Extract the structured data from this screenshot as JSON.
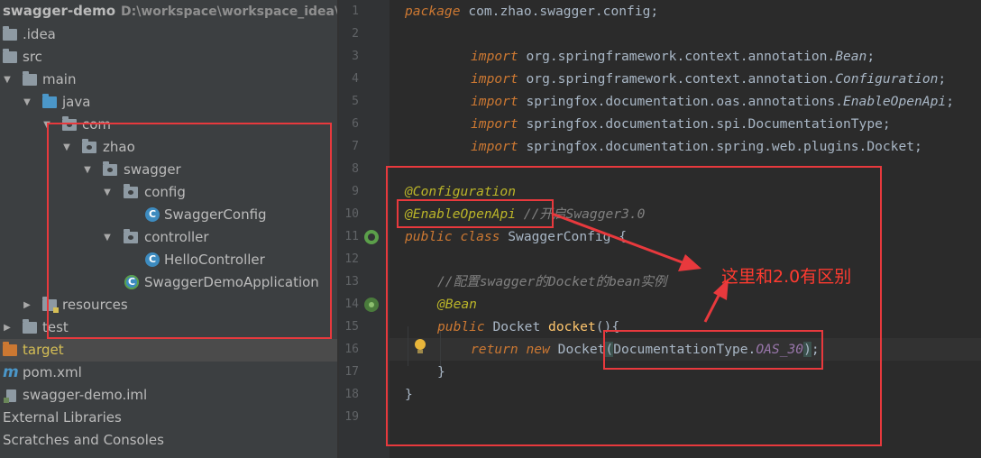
{
  "project": {
    "root_name": "swagger-demo",
    "root_path": "D:\\workspace\\workspace_idea\\java",
    "items": [
      {
        "label": ".idea"
      },
      {
        "label": "src"
      },
      {
        "label": "main"
      },
      {
        "label": "java"
      },
      {
        "label": "com"
      },
      {
        "label": "zhao"
      },
      {
        "label": "swagger"
      },
      {
        "label": "config"
      },
      {
        "label": "SwaggerConfig"
      },
      {
        "label": "controller"
      },
      {
        "label": "HelloController"
      },
      {
        "label": "SwaggerDemoApplication"
      },
      {
        "label": "resources"
      },
      {
        "label": "test"
      },
      {
        "label": "target"
      },
      {
        "label": "pom.xml"
      },
      {
        "label": "swagger-demo.iml"
      },
      {
        "label": "External Libraries"
      },
      {
        "label": "Scratches and Consoles"
      }
    ],
    "icons": {
      "class_letter": "C",
      "maven_letter": "m"
    }
  },
  "editor": {
    "line_numbers": [
      "1",
      "2",
      "3",
      "4",
      "5",
      "6",
      "7",
      "8",
      "9",
      "10",
      "11",
      "12",
      "13",
      "14",
      "15",
      "16",
      "17",
      "18",
      "19"
    ],
    "line1": {
      "kw": "package",
      "pkg": "com.zhao.swagger.config;"
    },
    "imports": [
      {
        "kw": "import",
        "pkg": "org.springframework.context.annotation.",
        "cls": "Bean",
        "end": ";"
      },
      {
        "kw": "import",
        "pkg": "org.springframework.context.annotation.",
        "cls": "Configuration",
        "end": ";"
      },
      {
        "kw": "import",
        "pkg": "springfox.documentation.oas.annotations.",
        "cls": "EnableOpenApi",
        "end": ";"
      },
      {
        "kw": "import",
        "pkg": "springfox.documentation.spi.DocumentationType;",
        "cls": "",
        "end": ""
      },
      {
        "kw": "import",
        "pkg": "springfox.documentation.spring.web.plugins.Docket;",
        "cls": "",
        "end": ""
      }
    ],
    "line9": "@Configuration",
    "line10": {
      "ann": "@EnableOpenApi",
      "comment": " //开启Swagger3.0"
    },
    "line11": {
      "kw1": "public",
      "kw2": "class",
      "name": "SwaggerConfig {"
    },
    "line13": "//配置swagger的Docket的bean实例",
    "line14": "@Bean",
    "line15": {
      "kw": "public",
      "type": "Docket ",
      "method": "docket",
      "rest": "(){"
    },
    "line16": {
      "kw1": "return",
      "kw2": "new",
      "cls": "Docket",
      "lparen": "(",
      "arg": "DocumentationType.",
      "const": "OAS_30",
      "rparen": ")",
      "end": ";"
    },
    "line17": "}",
    "line18": "}"
  },
  "annotation_note": "这里和2.0有区别",
  "colors": {
    "highlight_red": "#e8393d",
    "note_red": "#ff3b30"
  }
}
